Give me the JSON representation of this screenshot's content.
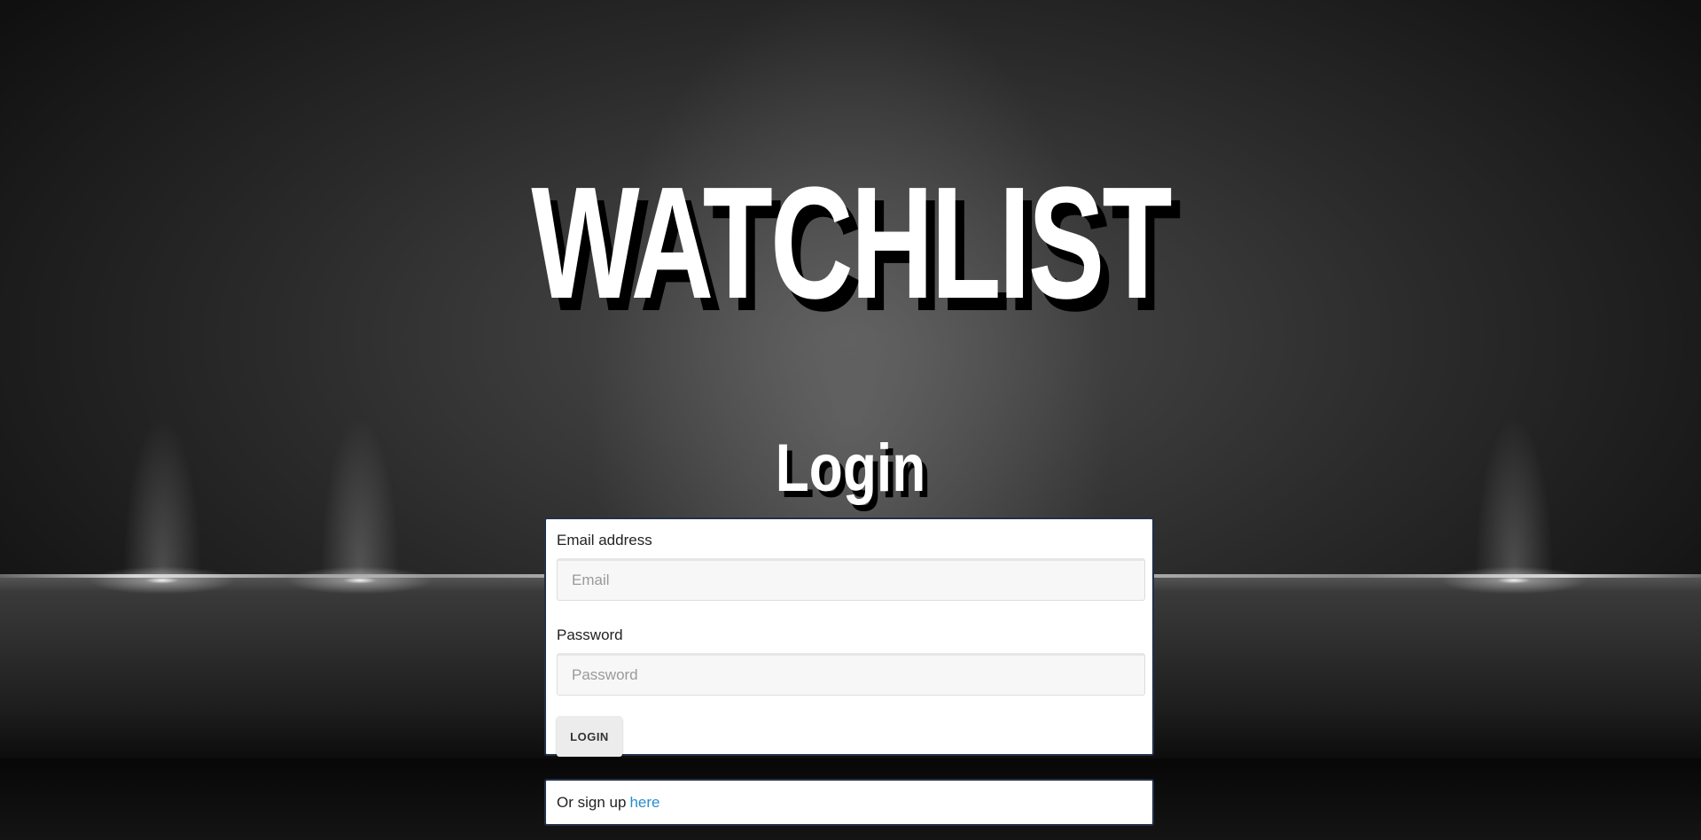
{
  "site": {
    "title": "WATCHLIST"
  },
  "login": {
    "heading": "Login",
    "email_label": "Email address",
    "email_placeholder": "Email",
    "email_value": "",
    "password_label": "Password",
    "password_placeholder": "Password",
    "password_value": "",
    "submit_label": "LOGIN"
  },
  "signup": {
    "prompt": "Or sign up",
    "link_label": "here"
  },
  "colors": {
    "link": "#2a8dc9",
    "card_border": "#22314a",
    "title_text": "#ffffff"
  }
}
